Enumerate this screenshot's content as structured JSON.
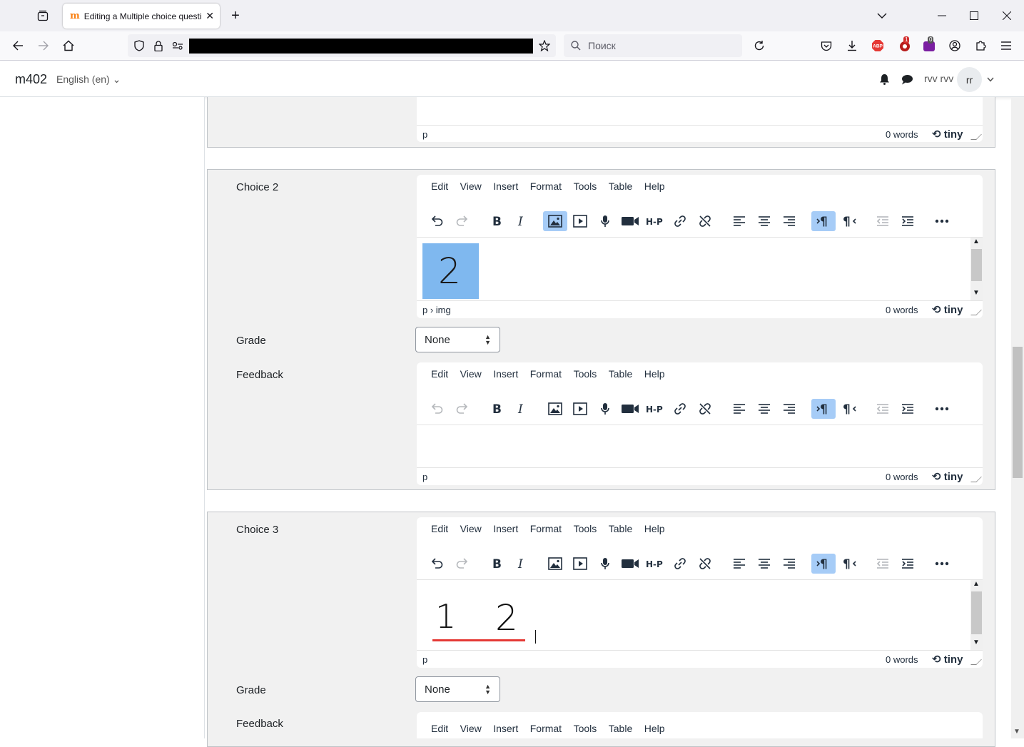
{
  "browser": {
    "tab_title": "Editing a Multiple choice questi",
    "tab_favicon": "m",
    "search_placeholder": "Поиск",
    "badges": {
      "shield_ext": "1",
      "purple_ext": "0"
    },
    "abp_label": "ABP"
  },
  "header": {
    "site_name": "m402",
    "language": "English (en) ⌄",
    "user_name": "rvv rvv",
    "avatar_initials": "rr"
  },
  "editor": {
    "menu": [
      "Edit",
      "View",
      "Insert",
      "Format",
      "Tools",
      "Table",
      "Help"
    ],
    "brand": "tiny",
    "toolbar_icons": [
      "undo-icon",
      "redo-icon",
      "bold-icon",
      "italic-icon",
      "image-icon",
      "media-icon",
      "microphone-icon",
      "video-camera-icon",
      "h5p-icon",
      "link-icon",
      "unlink-icon",
      "align-left-icon",
      "align-center-icon",
      "align-right-icon",
      "ltr-icon",
      "rtl-icon",
      "outdent-icon",
      "indent-icon",
      "more-icon"
    ]
  },
  "top_editor": {
    "path": "p",
    "words": "0 words"
  },
  "choice2": {
    "label": "Choice 2",
    "path": "p › img",
    "words": "0 words",
    "image_text": "2",
    "grade_label": "Grade",
    "grade_value": "None",
    "feedback_label": "Feedback",
    "feedback_path": "p",
    "feedback_words": "0 words"
  },
  "choice3": {
    "label": "Choice 3",
    "path": "p",
    "words": "0 words",
    "drawing_text_1": "1",
    "drawing_text_2": "2",
    "grade_label": "Grade",
    "grade_value": "None",
    "feedback_label": "Feedback"
  }
}
